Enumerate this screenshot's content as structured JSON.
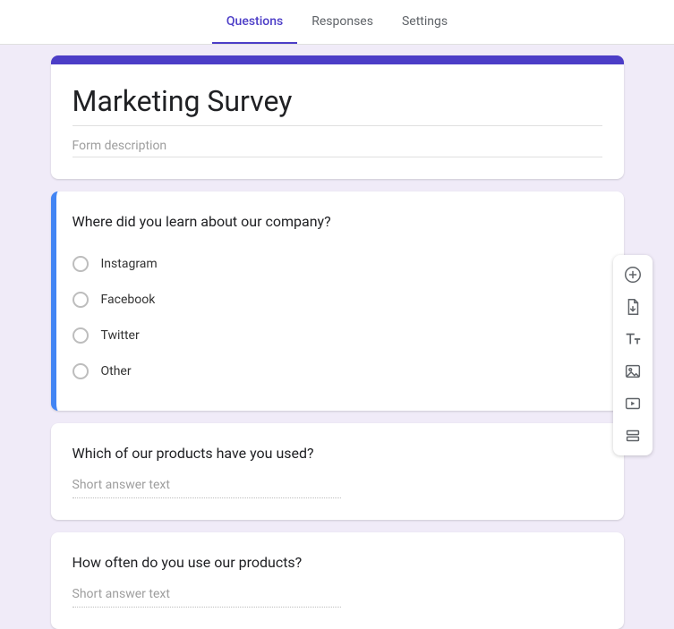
{
  "tabs": {
    "questions": "Questions",
    "responses": "Responses",
    "settings": "Settings"
  },
  "form": {
    "title": "Marketing Survey",
    "description_placeholder": "Form description"
  },
  "questions": [
    {
      "title": "Where did you learn about our company?",
      "options": [
        {
          "label": "Instagram"
        },
        {
          "label": "Facebook"
        },
        {
          "label": "Twitter"
        },
        {
          "label": "Other"
        }
      ]
    },
    {
      "title": "Which of our products have you used?",
      "short_answer_placeholder": "Short answer text"
    },
    {
      "title": "How often do you use our products?",
      "short_answer_placeholder": "Short answer text"
    }
  ],
  "toolbox": {
    "add_question": "Add question",
    "import_questions": "Import questions",
    "add_title": "Add title and description",
    "add_image": "Add image",
    "add_video": "Add video",
    "add_section": "Add section"
  }
}
